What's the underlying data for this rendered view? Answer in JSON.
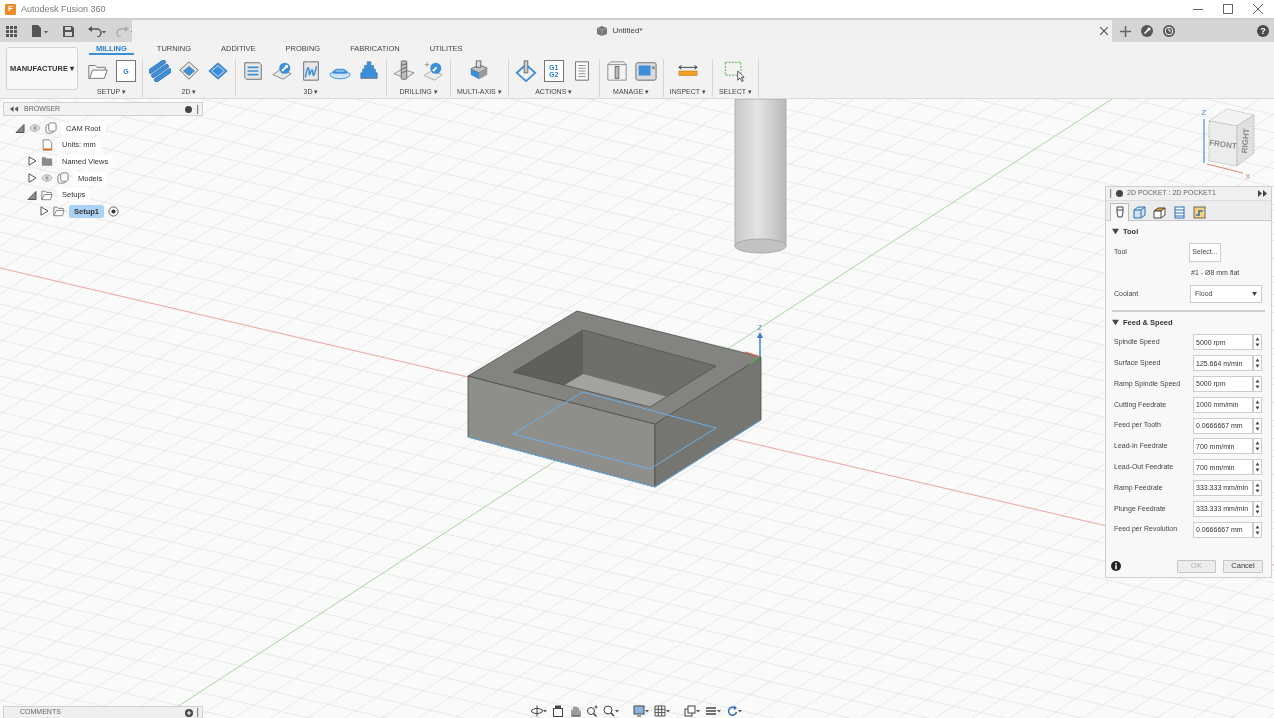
{
  "window": {
    "logo": "F",
    "title": "Autodesk Fusion 360"
  },
  "document_tab": {
    "title": "Untitled*"
  },
  "help": {
    "label": "?"
  },
  "ribbon": {
    "workspace": "MANUFACTURE ▾",
    "tabs": [
      {
        "label": "MILLING",
        "selected": true
      },
      {
        "label": "TURNING",
        "selected": false
      },
      {
        "label": "ADDITIVE",
        "selected": false
      },
      {
        "label": "PROBING",
        "selected": false
      },
      {
        "label": "FABRICATION",
        "selected": false
      },
      {
        "label": "UTILITES",
        "selected": false
      }
    ],
    "groups": [
      {
        "label": "SETUP ▾",
        "tools": [
          {
            "kind": "folder"
          },
          {
            "kind": "program",
            "text": [
              "G"
            ]
          }
        ]
      },
      {
        "label": "2D ▾",
        "tools": [
          {
            "kind": "coil"
          },
          {
            "kind": "pocket"
          },
          {
            "kind": "face"
          }
        ]
      },
      {
        "label": "3D ▾",
        "tools": [
          {
            "kind": "block"
          },
          {
            "kind": "wrench"
          },
          {
            "kind": "spiral"
          },
          {
            "kind": "dome"
          },
          {
            "kind": "tiers"
          }
        ]
      },
      {
        "label": "DRILLING ▾",
        "tools": [
          {
            "kind": "drill"
          },
          {
            "kind": "probe"
          }
        ]
      },
      {
        "label": "MULTI-AXIS ▾",
        "tools": [
          {
            "kind": "tilted"
          }
        ]
      },
      {
        "label": "ACTIONS ▾",
        "tools": [
          {
            "kind": "simulate"
          },
          {
            "kind": "program",
            "text": [
              "G1",
              "G2"
            ]
          },
          {
            "kind": "sheet"
          }
        ]
      },
      {
        "label": "MANAGE ▾",
        "tools": [
          {
            "kind": "library"
          },
          {
            "kind": "machine"
          }
        ]
      },
      {
        "label": "INSPECT ▾",
        "tools": [
          {
            "kind": "measure"
          }
        ]
      },
      {
        "label": "SELECT ▾",
        "tools": [
          {
            "kind": "window"
          }
        ]
      }
    ]
  },
  "browser": {
    "title": "BROWSER",
    "items": [
      {
        "kind": "component",
        "label": "CAM Root",
        "expanded": true,
        "selected": false,
        "children": [
          {
            "kind": "units",
            "label": "Units: mm",
            "selected": false
          },
          {
            "kind": "folder",
            "label": "Named Views",
            "expanded": false,
            "selected": false
          },
          {
            "kind": "component",
            "label": "Models",
            "expanded": false,
            "selected": false
          },
          {
            "kind": "setups",
            "label": "Setups",
            "expanded": true,
            "selected": false,
            "children": [
              {
                "kind": "setup",
                "label": "Setup1",
                "expanded": false,
                "selected": true
              }
            ]
          }
        ]
      }
    ]
  },
  "viewport": {
    "triad_label": "Z",
    "view_cube": {
      "faces": [
        "FRONT",
        "RIGHT"
      ],
      "axes": [
        "Z",
        "X"
      ]
    }
  },
  "dialog": {
    "title": "2D POCKET : 2D POCKET1",
    "tabs": [
      {
        "kind": "tool",
        "selected": true
      },
      {
        "kind": "geometry",
        "selected": false
      },
      {
        "kind": "heights",
        "selected": false
      },
      {
        "kind": "passes",
        "selected": false
      },
      {
        "kind": "linking",
        "selected": false
      }
    ],
    "sections": [
      {
        "title": "Tool",
        "expanded": true,
        "rows": [
          {
            "kind": "button",
            "label": "Tool",
            "value": "Select..."
          },
          {
            "kind": "note",
            "value": "#1 - Ø8 mm flat"
          },
          {
            "kind": "select",
            "label": "Coolant",
            "value": "Flood"
          }
        ]
      },
      {
        "title": "Feed & Speed",
        "expanded": true,
        "rows": [
          {
            "kind": "spinner",
            "label": "Spindle Speed",
            "value": "5000 rpm"
          },
          {
            "kind": "spinner",
            "label": "Surface Speed",
            "value": "125.664 m/min"
          },
          {
            "kind": "spinner",
            "label": "Ramp Spindle Speed",
            "value": "5000 rpm"
          },
          {
            "kind": "spinner",
            "label": "Cutting Feedrate",
            "value": "1000 mm/min"
          },
          {
            "kind": "spinner",
            "label": "Feed per Tooth",
            "value": "0.0666667 mm"
          },
          {
            "kind": "spinner",
            "label": "Lead-In Feedrate",
            "value": "700 mm/min"
          },
          {
            "kind": "spinner",
            "label": "Lead-Out Feedrate",
            "value": "700 mm/min"
          },
          {
            "kind": "spinner",
            "label": "Ramp Feedrate",
            "value": "333.333 mm/min"
          },
          {
            "kind": "spinner",
            "label": "Plunge Feedrate",
            "value": "333.333 mm/min"
          },
          {
            "kind": "spinner",
            "label": "Feed per Revolution",
            "value": "0.0666667 mm"
          }
        ]
      }
    ],
    "buttons": [
      {
        "label": "OK",
        "disabled": true
      },
      {
        "label": "Cancel",
        "disabled": false
      }
    ]
  },
  "comments": {
    "title": "COMMENTS"
  }
}
